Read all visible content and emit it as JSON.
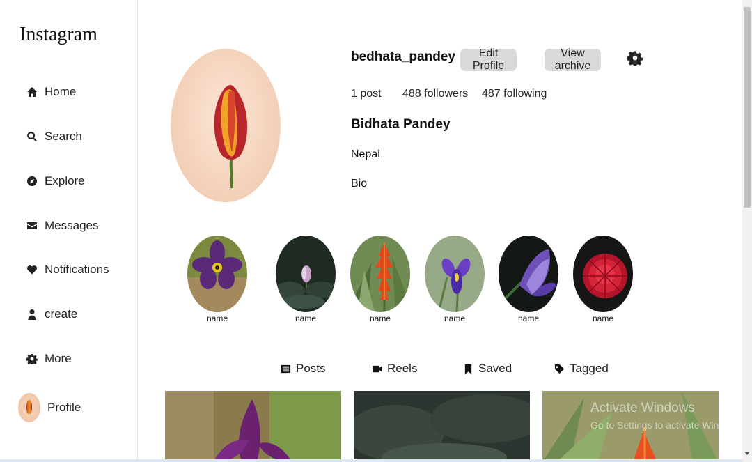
{
  "app": {
    "logo": "Instagram"
  },
  "sidebar": {
    "items": [
      {
        "label": "Home",
        "icon": "home-icon"
      },
      {
        "label": "Search",
        "icon": "search-icon"
      },
      {
        "label": "Explore",
        "icon": "compass-icon"
      },
      {
        "label": "Messages",
        "icon": "envelope-icon"
      },
      {
        "label": "Notifications",
        "icon": "heart-icon"
      },
      {
        "label": "create",
        "icon": "user-icon"
      },
      {
        "label": "More",
        "icon": "gear-icon"
      }
    ],
    "profile": {
      "label": "Profile",
      "icon": "profile-avatar"
    }
  },
  "profile": {
    "username": "bedhata_pandey",
    "edit_button": "Edit Profile",
    "archive_button": "View archive",
    "posts": "1 post",
    "followers": "488 followers",
    "following": "487 following",
    "full_name": "Bidhata Pandey",
    "location": "Nepal",
    "bio": "Bio"
  },
  "highlights": [
    {
      "label": "name"
    },
    {
      "label": "name"
    },
    {
      "label": "name"
    },
    {
      "label": "name"
    },
    {
      "label": "name"
    },
    {
      "label": "name"
    }
  ],
  "tabs": [
    {
      "label": "Posts",
      "icon": "grid-icon"
    },
    {
      "label": "Reels",
      "icon": "video-icon"
    },
    {
      "label": "Saved",
      "icon": "bookmark-icon"
    },
    {
      "label": "Tagged",
      "icon": "tag-icon"
    }
  ],
  "watermark": {
    "title": "Activate Windows",
    "subtitle": "Go to Settings to activate Windows."
  },
  "colors": {
    "button_bg": "#d9d9d9",
    "sidebar_border": "#e3e3e3"
  }
}
